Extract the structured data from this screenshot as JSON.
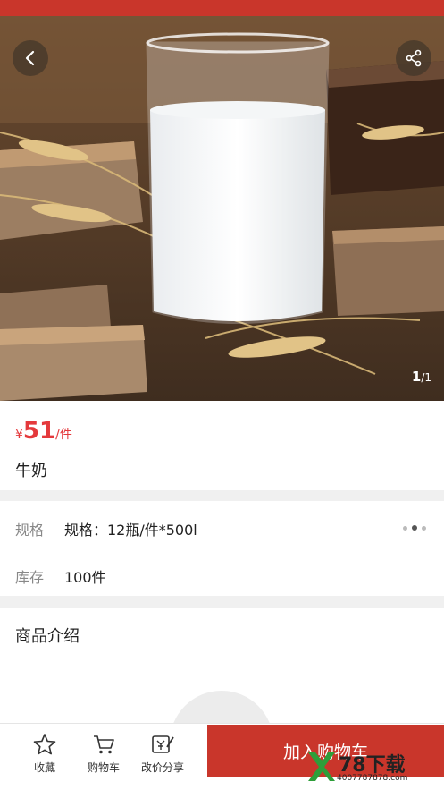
{
  "header": {
    "back_icon": "chevron-left-icon",
    "share_icon": "share-icon",
    "gallery_current": "1",
    "gallery_total": "/1"
  },
  "product": {
    "currency": "¥",
    "price": "51",
    "price_unit": "/件",
    "name": "牛奶"
  },
  "specs": {
    "spec_label": "规格",
    "spec_value": "规格：12瓶/件*500l",
    "stock_label": "库存",
    "stock_value": "100件"
  },
  "intro": {
    "title": "商品介绍"
  },
  "bottom_bar": {
    "favorite_label": "收藏",
    "cart_label": "购物车",
    "share_label": "改价分享",
    "add_to_cart_label": "加入购物车"
  },
  "watermark": {
    "brand": "78下载",
    "url": "4007787878.com"
  },
  "colors": {
    "accent": "#c9362b",
    "price": "#e4393c"
  }
}
